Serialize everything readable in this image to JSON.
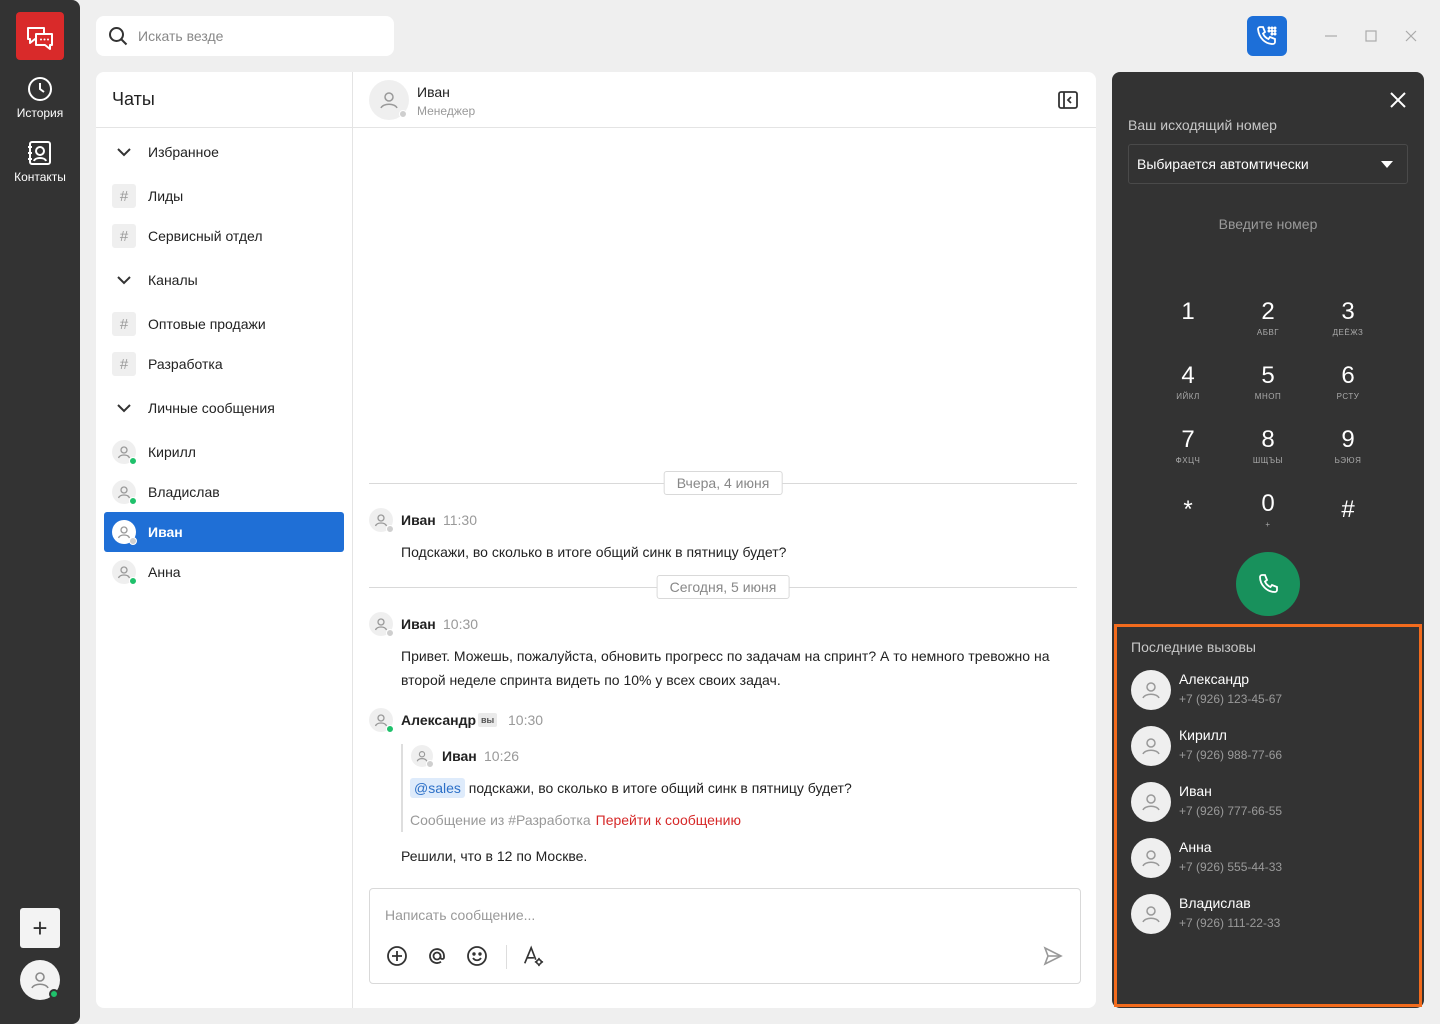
{
  "app": {
    "accent": "#1f6fd6",
    "brand": "#d92a2a",
    "highlight": "#f26b1d"
  },
  "rail": {
    "items": [
      {
        "label": "История",
        "icon": "clock-icon"
      },
      {
        "label": "Контакты",
        "icon": "contacts-icon"
      }
    ],
    "add_label": "+"
  },
  "search": {
    "placeholder": "Искать везде"
  },
  "chats": {
    "title": "Чаты",
    "sections": [
      {
        "label": "Избранное"
      },
      {
        "label": "Каналы"
      },
      {
        "label": "Личные сообщения"
      }
    ],
    "favorites": [
      "Лиды",
      "Сервисный отдел"
    ],
    "channels": [
      "Оптовые продажи",
      "Разработка"
    ],
    "direct": [
      "Кирилл",
      "Владислав",
      "Иван",
      "Анна"
    ],
    "active": "Иван"
  },
  "conversation": {
    "name": "Иван",
    "role": "Менеджер",
    "date1": "Вчера, 4 июня",
    "date2": "Сегодня, 5 июня",
    "messages": [
      {
        "author": "Иван",
        "time": "11:30",
        "text": "Подскажи, во сколько в итоге общий синк в пятницу будет?"
      },
      {
        "author": "Иван",
        "time": "10:30",
        "text_line1": "Привет. Можешь, пожалуйста, обновить прогресс по задачам на спринт? А то немного тревожно на",
        "text_line2": "второй неделе спринта видеть по 10% у всех своих задач."
      },
      {
        "author": "Александр",
        "badge": "вы",
        "time": "10:30",
        "text": "Решили, что в 12 по Москве."
      }
    ],
    "quote": {
      "author": "Иван",
      "time": "10:26",
      "mention": "@sales",
      "text": "подскажи, во сколько в итоге общий синк в пятницу будет?",
      "source": "Сообщение из #Разработка",
      "link": "Перейти к сообщению"
    },
    "composer_placeholder": "Написать сообщение..."
  },
  "dialer": {
    "outgoing_label": "Ваш исходящий номер",
    "outgoing_value": "Выбирается автомтически",
    "number_placeholder": "Введите номер",
    "keys": [
      {
        "d": "1",
        "l": ""
      },
      {
        "d": "2",
        "l": "АБВГ"
      },
      {
        "d": "3",
        "l": "ДЕЁЖЗ"
      },
      {
        "d": "4",
        "l": "ИЙКЛ"
      },
      {
        "d": "5",
        "l": "МНОП"
      },
      {
        "d": "6",
        "l": "РСТУ"
      },
      {
        "d": "7",
        "l": "ФХЦЧ"
      },
      {
        "d": "8",
        "l": "ШЩЪЫ"
      },
      {
        "d": "9",
        "l": "ЬЭЮЯ"
      },
      {
        "d": "*",
        "l": ""
      },
      {
        "d": "0",
        "l": "+"
      },
      {
        "d": "#",
        "l": ""
      }
    ],
    "recent_title": "Последние вызовы",
    "recent": [
      {
        "name": "Александр",
        "phone": "+7 (926) 123-45-67"
      },
      {
        "name": "Кирилл",
        "phone": "+7 (926) 988-77-66"
      },
      {
        "name": "Иван",
        "phone": "+7 (926) 777-66-55"
      },
      {
        "name": "Анна",
        "phone": "+7 (926) 555-44-33"
      },
      {
        "name": "Владислав",
        "phone": "+7 (926) 111-22-33"
      }
    ]
  }
}
